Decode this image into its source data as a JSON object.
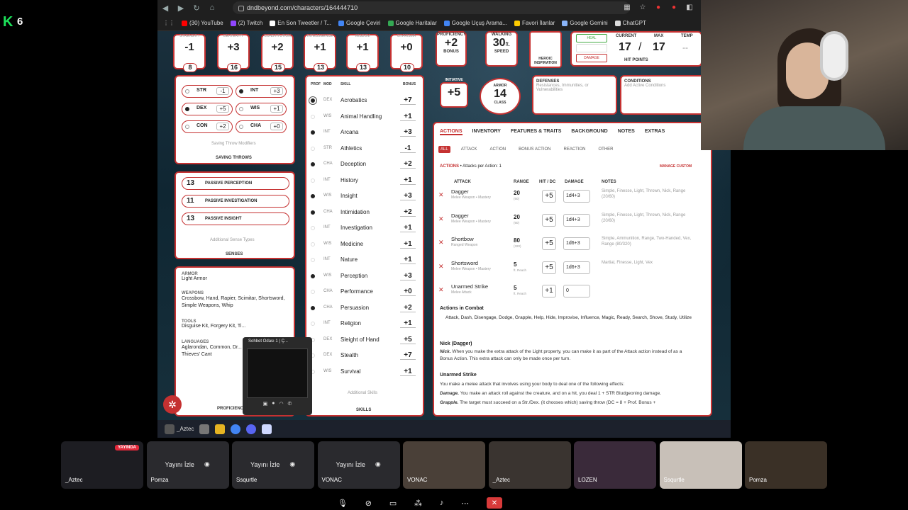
{
  "corner": {
    "logo": "K",
    "count": "6"
  },
  "browser": {
    "url": "dndbeyond.com/characters/164444710",
    "bookmarks": [
      "(30) YouTube",
      "(2) Twitch",
      "En Son Tweetler / T...",
      "Google Çeviri",
      "Google Haritalar",
      "Google Uçuş Arama...",
      "Favori İlanlar",
      "Google Gemini",
      "ChatGPT"
    ]
  },
  "abilities": [
    {
      "label": "STRENGTH",
      "mod": "-1",
      "score": "8"
    },
    {
      "label": "DEXTERITY",
      "mod": "+3",
      "score": "16"
    },
    {
      "label": "CONSTITUTION",
      "mod": "+2",
      "score": "15"
    },
    {
      "label": "INTELLIGENCE",
      "mod": "+1",
      "score": "13"
    },
    {
      "label": "WISDOM",
      "mod": "+1",
      "score": "13"
    },
    {
      "label": "CHARISMA",
      "mod": "+0",
      "score": "10"
    }
  ],
  "proficiency": {
    "value": "+2",
    "label": "BONUS",
    "top": "PROFICIENCY"
  },
  "speed": {
    "value": "30",
    "unit": "ft.",
    "label": "SPEED",
    "top": "WALKING"
  },
  "inspiration": "HEROIC INSPIRATION",
  "hp": {
    "heal": "HEAL",
    "damage": "DAMAGE",
    "current_label": "CURRENT",
    "max_label": "MAX",
    "temp_label": "TEMP",
    "current": "17",
    "sep": "/",
    "max": "17",
    "temp": "--",
    "label": "HIT POINTS"
  },
  "initiative": {
    "label": "INITIATIVE",
    "value": "+5"
  },
  "armor": {
    "top": "ARMOR",
    "value": "14",
    "bottom": "CLASS"
  },
  "defenses": {
    "title": "DEFENSES",
    "text": "Resistances, Immunities, or Vulnerabilities"
  },
  "conditions": {
    "title": "CONDITIONS",
    "text": "Add Active Conditions"
  },
  "saves": [
    {
      "name": "STR",
      "val": "-1",
      "prof": false
    },
    {
      "name": "INT",
      "val": "+3",
      "prof": true
    },
    {
      "name": "DEX",
      "val": "+5",
      "prof": true
    },
    {
      "name": "WIS",
      "val": "+1",
      "prof": false
    },
    {
      "name": "CON",
      "val": "+2",
      "prof": false
    },
    {
      "name": "CHA",
      "val": "+0",
      "prof": false
    }
  ],
  "saves_modifiers": "Saving Throw Modifiers",
  "saves_title": "SAVING THROWS",
  "senses": [
    {
      "val": "13",
      "name": "PASSIVE PERCEPTION"
    },
    {
      "val": "11",
      "name": "PASSIVE INVESTIGATION"
    },
    {
      "val": "13",
      "name": "PASSIVE INSIGHT"
    }
  ],
  "senses_additional": "Additional Sense Types",
  "senses_title": "SENSES",
  "prof_panel": {
    "armor_title": "ARMOR",
    "armor": "Light Armor",
    "weapons_title": "WEAPONS",
    "weapons": "Crossbow, Hand, Rapier, Scimitar, Shortsword, Simple Weapons, Whip",
    "tools_title": "TOOLS",
    "tools": "Disguise Kit, Forgery Kit, Ti...",
    "languages_title": "LANGUAGES",
    "languages": "Aglarondan, Common, Dr... Thieves' Cant",
    "footer": "PROFICIENCIES &"
  },
  "skills_header": {
    "prof": "PROF",
    "mod": "MOD",
    "skill": "SKILL",
    "bonus": "BONUS"
  },
  "skills": [
    {
      "mod": "DEX",
      "name": "Acrobatics",
      "bonus": "+7",
      "prof": "expert"
    },
    {
      "mod": "WIS",
      "name": "Animal Handling",
      "bonus": "+1",
      "prof": "none"
    },
    {
      "mod": "INT",
      "name": "Arcana",
      "bonus": "+3",
      "prof": "yes"
    },
    {
      "mod": "STR",
      "name": "Athletics",
      "bonus": "-1",
      "prof": "none"
    },
    {
      "mod": "CHA",
      "name": "Deception",
      "bonus": "+2",
      "prof": "yes"
    },
    {
      "mod": "INT",
      "name": "History",
      "bonus": "+1",
      "prof": "none"
    },
    {
      "mod": "WIS",
      "name": "Insight",
      "bonus": "+3",
      "prof": "yes"
    },
    {
      "mod": "CHA",
      "name": "Intimidation",
      "bonus": "+2",
      "prof": "yes"
    },
    {
      "mod": "INT",
      "name": "Investigation",
      "bonus": "+1",
      "prof": "none"
    },
    {
      "mod": "WIS",
      "name": "Medicine",
      "bonus": "+1",
      "prof": "none"
    },
    {
      "mod": "INT",
      "name": "Nature",
      "bonus": "+1",
      "prof": "none"
    },
    {
      "mod": "WIS",
      "name": "Perception",
      "bonus": "+3",
      "prof": "yes"
    },
    {
      "mod": "CHA",
      "name": "Performance",
      "bonus": "+0",
      "prof": "none"
    },
    {
      "mod": "CHA",
      "name": "Persuasion",
      "bonus": "+2",
      "prof": "yes"
    },
    {
      "mod": "INT",
      "name": "Religion",
      "bonus": "+1",
      "prof": "none"
    },
    {
      "mod": "DEX",
      "name": "Sleight of Hand",
      "bonus": "+5",
      "prof": "none"
    },
    {
      "mod": "DEX",
      "name": "Stealth",
      "bonus": "+7",
      "prof": "none"
    },
    {
      "mod": "WIS",
      "name": "Survival",
      "bonus": "+1",
      "prof": "none"
    }
  ],
  "skills_additional": "Additional Skills",
  "skills_title": "SKILLS",
  "tabs": [
    "ACTIONS",
    "INVENTORY",
    "FEATURES & TRAITS",
    "BACKGROUND",
    "NOTES",
    "EXTRAS"
  ],
  "subtabs": [
    "ALL",
    "ATTACK",
    "ACTION",
    "BONUS ACTION",
    "REACTION",
    "OTHER"
  ],
  "actions": {
    "title": "ACTIONS",
    "per_action": "• Attacks per Action: 1",
    "manage": "MANAGE CUSTOM",
    "headers": {
      "attack": "ATTACK",
      "range": "RANGE",
      "hit": "HIT / DC",
      "damage": "DAMAGE",
      "notes": "NOTES"
    },
    "rows": [
      {
        "name": "Dagger",
        "sub": "Melee Weapon • Mastery",
        "range": "20",
        "range_sub": "(60)",
        "hit": "+5",
        "dmg": "1d4+3",
        "notes": "Simple, Finesse, Light, Thrown, Nick, Range (20/60)"
      },
      {
        "name": "Dagger",
        "sub": "Melee Weapon • Mastery",
        "range": "20",
        "range_sub": "(60)",
        "hit": "+5",
        "dmg": "1d4+3",
        "notes": "Simple, Finesse, Light, Thrown, Nick, Range (20/60)"
      },
      {
        "name": "Shortbow",
        "sub": "Ranged Weapon",
        "range": "80",
        "range_sub": "(320)",
        "hit": "+5",
        "dmg": "1d6+3",
        "notes": "Simple, Ammunition, Range, Two-Handed, Vex, Range (80/320)"
      },
      {
        "name": "Shortsword",
        "sub": "Melee Weapon • Mastery",
        "range": "5",
        "range_sub": "ft. Reach",
        "hit": "+5",
        "dmg": "1d6+3",
        "notes": "Martial, Finesse, Light, Vex"
      },
      {
        "name": "Unarmed Strike",
        "sub": "Melee Attack",
        "range": "5",
        "range_sub": "ft. Reach",
        "hit": "+1",
        "dmg": "0",
        "notes": ""
      }
    ],
    "combat_title": "Actions in Combat",
    "combat_list": "Attack, Dash, Disengage, Dodge, Grapple, Help, Hide, Improvise, Influence, Magic, Ready, Search, Shove, Study, Utilize",
    "nick_title": "Nick (Dagger)",
    "nick_label": "Nick.",
    "nick_text": "When you make the extra attack of the Light property, you can make it as part of the Attack action instead of as a Bonus Action. This extra attack can only be made once per turn.",
    "unarmed_title": "Unarmed Strike",
    "unarmed_text": "You make a melee attack that involves using your body to deal one of the following effects:",
    "damage_label": "Damage.",
    "damage_text": "You make an attack roll against the creature, and on a hit, you deal 1 + STR Bludgeoning damage.",
    "grapple_label": "Grapple.",
    "grapple_text": "The target must succeed on a Str./Dex. (it chooses which) saving throw (DC = 8 + Prof. Bonus +"
  },
  "chat_popup": {
    "title": "Sohbet Odası 1 | Ç..."
  },
  "taskbar": {
    "active": "_Aztec"
  },
  "tiles": [
    {
      "name": "_Aztec",
      "live": "YAYINDA",
      "watch": ""
    },
    {
      "name": "Pomza",
      "live": "",
      "watch": "Yayını İzle"
    },
    {
      "name": "Ssqurtle",
      "live": "",
      "watch": "Yayını İzle"
    },
    {
      "name": "VONAC",
      "live": "",
      "watch": "Yayını İzle"
    },
    {
      "name": "VONAC",
      "live": "",
      "watch": ""
    },
    {
      "name": "_Aztec",
      "live": "",
      "watch": ""
    },
    {
      "name": "LOZEN",
      "live": "",
      "watch": ""
    },
    {
      "name": "Ssqurtle",
      "live": "",
      "watch": ""
    },
    {
      "name": "Pomza",
      "live": "",
      "watch": ""
    }
  ],
  "colors": {
    "accent": "#c53131",
    "live": "#e0283a",
    "brand_green": "#1ce35a"
  }
}
